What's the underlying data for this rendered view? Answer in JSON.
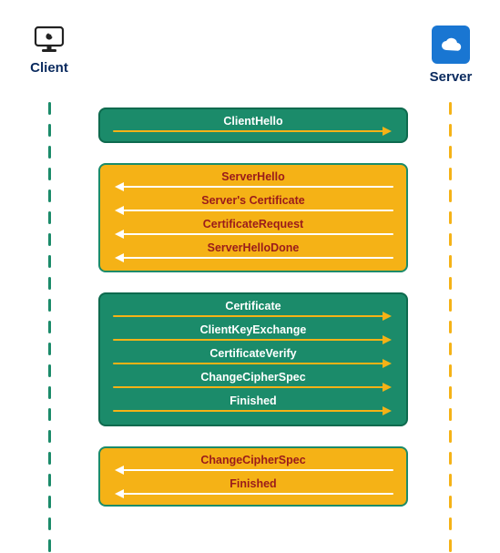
{
  "chart_data": {
    "type": "sequence",
    "title": "",
    "participants": [
      {
        "id": "client",
        "label": "Client"
      },
      {
        "id": "server",
        "label": "Server"
      }
    ],
    "groups": [
      {
        "origin": "client",
        "style": "teal",
        "messages": [
          {
            "from": "client",
            "to": "server",
            "label": "ClientHello"
          }
        ]
      },
      {
        "origin": "server",
        "style": "amber",
        "messages": [
          {
            "from": "server",
            "to": "client",
            "label": "ServerHello"
          },
          {
            "from": "server",
            "to": "client",
            "label": "Server's Certificate"
          },
          {
            "from": "server",
            "to": "client",
            "label": "CertificateRequest"
          },
          {
            "from": "server",
            "to": "client",
            "label": "ServerHelloDone"
          }
        ]
      },
      {
        "origin": "client",
        "style": "teal",
        "messages": [
          {
            "from": "client",
            "to": "server",
            "label": "Certificate"
          },
          {
            "from": "client",
            "to": "server",
            "label": "ClientKeyExchange"
          },
          {
            "from": "client",
            "to": "server",
            "label": "CertificateVerify"
          },
          {
            "from": "client",
            "to": "server",
            "label": "ChangeCipherSpec"
          },
          {
            "from": "client",
            "to": "server",
            "label": "Finished"
          }
        ]
      },
      {
        "origin": "server",
        "style": "amber",
        "messages": [
          {
            "from": "server",
            "to": "client",
            "label": "ChangeCipherSpec"
          },
          {
            "from": "server",
            "to": "client",
            "label": "Finished"
          }
        ]
      }
    ]
  },
  "colors": {
    "teal": "#1b8b6a",
    "amber": "#f5b216",
    "navy": "#0a2a5e",
    "serverBlue": "#1976d2",
    "maroon": "#9a1b1b"
  }
}
